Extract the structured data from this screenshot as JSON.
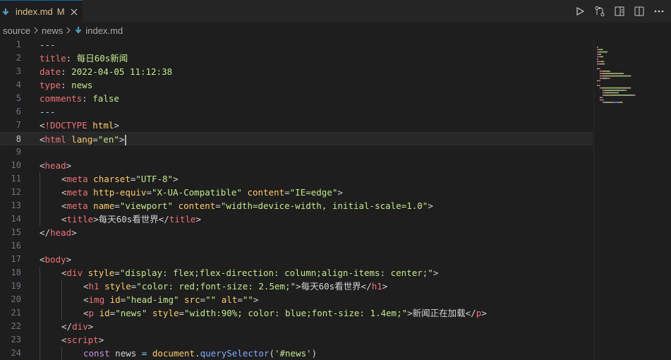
{
  "tab": {
    "filename": "index.md",
    "status": "M"
  },
  "breadcrumb": [
    "source",
    "news",
    "index.md"
  ],
  "colors": {
    "yaml_key": "#f07178",
    "string": "#c3e88d",
    "tag": "#f07178",
    "attr": "#ffcb6b",
    "keyword": "#c792ea",
    "function": "#82aaff",
    "text": "#d4d4d4",
    "punct": "#89ddff"
  },
  "lines": [
    {
      "n": "1",
      "indent": 0,
      "tokens": [
        [
          "punct",
          "---"
        ]
      ]
    },
    {
      "n": "2",
      "indent": 0,
      "tokens": [
        [
          "yaml_key",
          "title"
        ],
        [
          "text",
          ": "
        ],
        [
          "string",
          "每日60s新闻"
        ]
      ]
    },
    {
      "n": "3",
      "indent": 0,
      "tokens": [
        [
          "yaml_key",
          "date"
        ],
        [
          "text",
          ": "
        ],
        [
          "string",
          "2022-04-05 11:12:38"
        ]
      ]
    },
    {
      "n": "4",
      "indent": 0,
      "tokens": [
        [
          "yaml_key",
          "type"
        ],
        [
          "text",
          ": "
        ],
        [
          "string",
          "news"
        ]
      ]
    },
    {
      "n": "5",
      "indent": 0,
      "tokens": [
        [
          "yaml_key",
          "comments"
        ],
        [
          "text",
          ": "
        ],
        [
          "string",
          "false"
        ]
      ]
    },
    {
      "n": "6",
      "indent": 0,
      "tokens": [
        [
          "punct",
          "---"
        ]
      ]
    },
    {
      "n": "7",
      "indent": 0,
      "tokens": [
        [
          "text",
          "<"
        ],
        [
          "tag",
          "!DOCTYPE"
        ],
        [
          "text",
          " "
        ],
        [
          "attr",
          "html"
        ],
        [
          "text",
          ">"
        ]
      ]
    },
    {
      "n": "8",
      "indent": 0,
      "current": true,
      "tokens": [
        [
          "text",
          "<"
        ],
        [
          "tag",
          "html"
        ],
        [
          "text",
          " "
        ],
        [
          "attr",
          "lang"
        ],
        [
          "text",
          "="
        ],
        [
          "string",
          "\"en\""
        ],
        [
          "text",
          ">"
        ]
      ]
    },
    {
      "n": "9",
      "indent": 0,
      "tokens": []
    },
    {
      "n": "10",
      "indent": 0,
      "tokens": [
        [
          "text",
          "<"
        ],
        [
          "tag",
          "head"
        ],
        [
          "text",
          ">"
        ]
      ]
    },
    {
      "n": "11",
      "indent": 1,
      "tokens": [
        [
          "text",
          "<"
        ],
        [
          "tag",
          "meta"
        ],
        [
          "text",
          " "
        ],
        [
          "attr",
          "charset"
        ],
        [
          "text",
          "="
        ],
        [
          "string",
          "\"UTF-8\""
        ],
        [
          "text",
          ">"
        ]
      ]
    },
    {
      "n": "12",
      "indent": 1,
      "tokens": [
        [
          "text",
          "<"
        ],
        [
          "tag",
          "meta"
        ],
        [
          "text",
          " "
        ],
        [
          "attr",
          "http-equiv"
        ],
        [
          "text",
          "="
        ],
        [
          "string",
          "\"X-UA-Compatible\""
        ],
        [
          "text",
          " "
        ],
        [
          "attr",
          "content"
        ],
        [
          "text",
          "="
        ],
        [
          "string",
          "\"IE=edge\""
        ],
        [
          "text",
          ">"
        ]
      ]
    },
    {
      "n": "13",
      "indent": 1,
      "tokens": [
        [
          "text",
          "<"
        ],
        [
          "tag",
          "meta"
        ],
        [
          "text",
          " "
        ],
        [
          "attr",
          "name"
        ],
        [
          "text",
          "="
        ],
        [
          "string",
          "\"viewport\""
        ],
        [
          "text",
          " "
        ],
        [
          "attr",
          "content"
        ],
        [
          "text",
          "="
        ],
        [
          "string",
          "\"width=device-width, initial-scale=1.0\""
        ],
        [
          "text",
          ">"
        ]
      ]
    },
    {
      "n": "14",
      "indent": 1,
      "tokens": [
        [
          "text",
          "<"
        ],
        [
          "tag",
          "title"
        ],
        [
          "text",
          ">每天60s看世界</"
        ],
        [
          "tag",
          "title"
        ],
        [
          "text",
          ">"
        ]
      ]
    },
    {
      "n": "15",
      "indent": 0,
      "tokens": [
        [
          "text",
          "</"
        ],
        [
          "tag",
          "head"
        ],
        [
          "text",
          ">"
        ]
      ]
    },
    {
      "n": "16",
      "indent": 0,
      "tokens": []
    },
    {
      "n": "17",
      "indent": 0,
      "tokens": [
        [
          "text",
          "<"
        ],
        [
          "tag",
          "body"
        ],
        [
          "text",
          ">"
        ]
      ]
    },
    {
      "n": "18",
      "indent": 1,
      "tokens": [
        [
          "text",
          "<"
        ],
        [
          "tag",
          "div"
        ],
        [
          "text",
          " "
        ],
        [
          "attr",
          "style"
        ],
        [
          "text",
          "="
        ],
        [
          "string",
          "\"display: flex;flex-direction: column;align-items: center;\""
        ],
        [
          "text",
          ">"
        ]
      ]
    },
    {
      "n": "19",
      "indent": 2,
      "tokens": [
        [
          "text",
          "<"
        ],
        [
          "tag",
          "h1"
        ],
        [
          "text",
          " "
        ],
        [
          "attr",
          "style"
        ],
        [
          "text",
          "="
        ],
        [
          "string",
          "\"color: red;font-size: 2.5em;\""
        ],
        [
          "text",
          ">每天60s看世界</"
        ],
        [
          "tag",
          "h1"
        ],
        [
          "text",
          ">"
        ]
      ]
    },
    {
      "n": "20",
      "indent": 2,
      "tokens": [
        [
          "text",
          "<"
        ],
        [
          "tag",
          "img"
        ],
        [
          "text",
          " "
        ],
        [
          "attr",
          "id"
        ],
        [
          "text",
          "="
        ],
        [
          "string",
          "\"head-img\""
        ],
        [
          "text",
          " "
        ],
        [
          "attr",
          "src"
        ],
        [
          "text",
          "="
        ],
        [
          "string",
          "\"\""
        ],
        [
          "text",
          " "
        ],
        [
          "attr",
          "alt"
        ],
        [
          "text",
          "="
        ],
        [
          "string",
          "\"\""
        ],
        [
          "text",
          ">"
        ]
      ]
    },
    {
      "n": "21",
      "indent": 2,
      "tokens": [
        [
          "text",
          "<"
        ],
        [
          "tag",
          "p"
        ],
        [
          "text",
          " "
        ],
        [
          "attr",
          "id"
        ],
        [
          "text",
          "="
        ],
        [
          "string",
          "\"news\""
        ],
        [
          "text",
          " "
        ],
        [
          "attr",
          "style"
        ],
        [
          "text",
          "="
        ],
        [
          "string",
          "\"width:90%; color: blue;font-size: 1.4em;\""
        ],
        [
          "text",
          ">新闻正在加载</"
        ],
        [
          "tag",
          "p"
        ],
        [
          "text",
          ">"
        ]
      ]
    },
    {
      "n": "22",
      "indent": 1,
      "tokens": [
        [
          "text",
          "</"
        ],
        [
          "tag",
          "div"
        ],
        [
          "text",
          ">"
        ]
      ]
    },
    {
      "n": "23",
      "indent": 1,
      "tokens": [
        [
          "text",
          "<"
        ],
        [
          "tag",
          "script"
        ],
        [
          "text",
          ">"
        ]
      ]
    },
    {
      "n": "24",
      "indent": 2,
      "tokens": [
        [
          "keyword",
          "const"
        ],
        [
          "text",
          " news "
        ],
        [
          "punct",
          "="
        ],
        [
          "text",
          " "
        ],
        [
          "attr",
          "document"
        ],
        [
          "text",
          "."
        ],
        [
          "function",
          "querySelector"
        ],
        [
          "text",
          "("
        ],
        [
          "string",
          "'#news'"
        ],
        [
          "text",
          ")"
        ]
      ]
    }
  ]
}
